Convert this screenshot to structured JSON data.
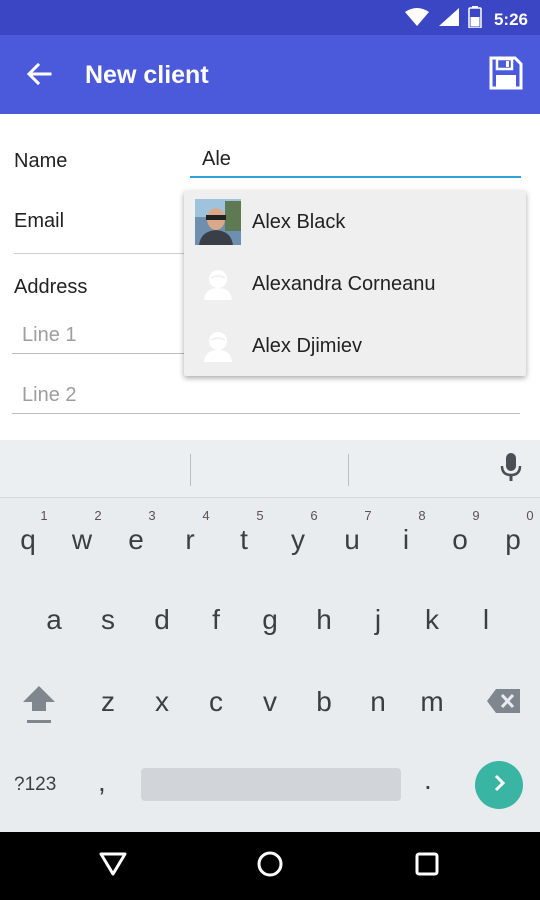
{
  "status_bar": {
    "time": "5:26",
    "icons": [
      "wifi-icon",
      "signal-icon",
      "battery-icon"
    ]
  },
  "app_bar": {
    "title": "New client",
    "back_icon": "arrow-back-icon",
    "save_icon": "floppy-disk-icon"
  },
  "form": {
    "name_label": "Name",
    "name_value": "Ale",
    "email_label": "Email",
    "address_label": "Address",
    "line1_placeholder": "Line 1",
    "line2_placeholder": "Line 2"
  },
  "autocomplete": {
    "items": [
      {
        "label": "Alex Black",
        "avatar": "photo-avatar"
      },
      {
        "label": "Alexandra Corneanu",
        "avatar": "default-person-icon"
      },
      {
        "label": "Alex Djimiev",
        "avatar": "default-person-icon"
      }
    ]
  },
  "keyboard": {
    "row1": [
      "q",
      "w",
      "e",
      "r",
      "t",
      "y",
      "u",
      "i",
      "o",
      "p"
    ],
    "row1_hints": [
      "1",
      "2",
      "3",
      "4",
      "5",
      "6",
      "7",
      "8",
      "9",
      "0"
    ],
    "row2": [
      "a",
      "s",
      "d",
      "f",
      "g",
      "h",
      "j",
      "k",
      "l"
    ],
    "row3": [
      "z",
      "x",
      "c",
      "v",
      "b",
      "n",
      "m"
    ],
    "symbols_label": "?123",
    "comma": ",",
    "period": ".",
    "icons": [
      "mic-icon",
      "shift-icon",
      "backspace-icon",
      "enter-arrow-icon"
    ]
  },
  "nav_bar": {
    "icons": [
      "back-triangle-icon",
      "home-circle-icon",
      "recents-square-icon"
    ]
  },
  "colors": {
    "status_bar": "#3a46c3",
    "app_bar": "#4a5adb",
    "field_underline_active": "#2ba3d9",
    "enter_key": "#3ab5a3"
  }
}
